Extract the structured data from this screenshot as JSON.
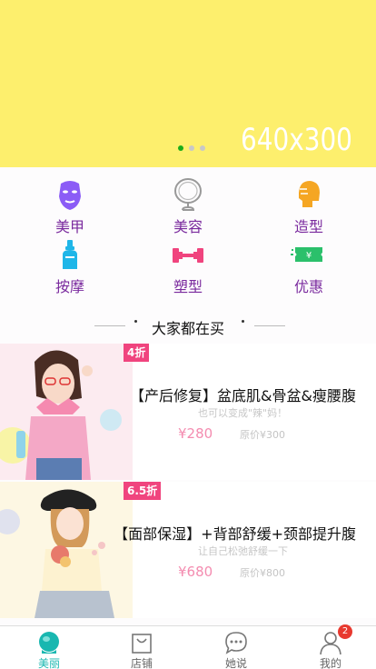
{
  "banner": {
    "text": "640x300",
    "background": "#fdef6d",
    "dots": [
      "active",
      "inactive",
      "inactive"
    ]
  },
  "categories": [
    {
      "label": "美甲",
      "icon": "mask-face-icon",
      "color": "#8b5cf6"
    },
    {
      "label": "美容",
      "icon": "mirror-icon",
      "color": "#888888"
    },
    {
      "label": "造型",
      "icon": "hair-icon",
      "color": "#f5a623"
    },
    {
      "label": "按摩",
      "icon": "bottle-icon",
      "color": "#1fb6e8"
    },
    {
      "label": "塑型",
      "icon": "dumbbell-icon",
      "color": "#f0447e"
    },
    {
      "label": "优惠",
      "icon": "coupon-icon",
      "color": "#2bc06b"
    }
  ],
  "section": {
    "title": "大家都在买"
  },
  "products": [
    {
      "badge": "4折",
      "title": "【产后修复】盆底肌&骨盆&瘦腰腹",
      "subtitle": "也可以变成\"辣\"妈！",
      "price": "¥280",
      "original_price": "原价¥300"
    },
    {
      "badge": "6.5折",
      "title": "【面部保湿】+背部舒缓+颈部提升腹",
      "subtitle": "让自己松弛舒缓一下",
      "price": "¥680",
      "original_price": "原价¥800"
    }
  ],
  "tabbar": {
    "tabs": [
      {
        "label": "美丽",
        "icon": "beauty-icon",
        "active": true
      },
      {
        "label": "店铺",
        "icon": "bag-icon",
        "active": false
      },
      {
        "label": "她说",
        "icon": "chat-icon",
        "active": false
      },
      {
        "label": "我的",
        "icon": "user-icon",
        "active": false,
        "badge": "2"
      }
    ],
    "accent": "#19b7b0"
  }
}
